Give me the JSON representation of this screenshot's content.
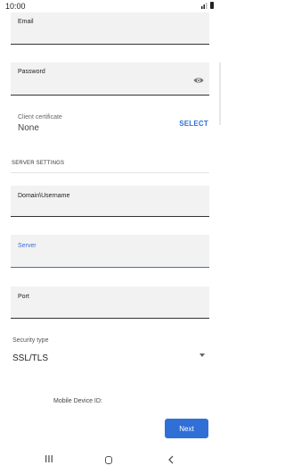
{
  "status_bar": {
    "time": "10:00",
    "icons": [
      "signal-icon",
      "battery-icon"
    ]
  },
  "form": {
    "email": {
      "label": "Email",
      "value": ""
    },
    "password": {
      "label": "Password",
      "value": "",
      "toggle_icon": "eye-icon"
    },
    "client_certificate": {
      "label": "Client certificate",
      "value": "None",
      "select_label": "SELECT"
    },
    "server_settings": {
      "title": "SERVER SETTINGS",
      "domain_username": {
        "label": "Domain\\Username",
        "value": ""
      },
      "server": {
        "label": "Server",
        "value": "",
        "focused": true
      },
      "port": {
        "label": "Port",
        "value": ""
      }
    },
    "security_type": {
      "label": "Security type",
      "value": "SSL/TLS",
      "dropdown_icon": "chevron-down-icon"
    },
    "mobile_device_id": {
      "label": "Mobile Device ID:",
      "value": ""
    },
    "next_label": "Next"
  },
  "nav_bar": {
    "icons": [
      "recent-apps-icon",
      "home-icon",
      "back-icon"
    ]
  },
  "colors": {
    "accent": "#2f6fd6",
    "field_background": "#f2f2f2",
    "focused_underline": "#3b6fd8"
  }
}
